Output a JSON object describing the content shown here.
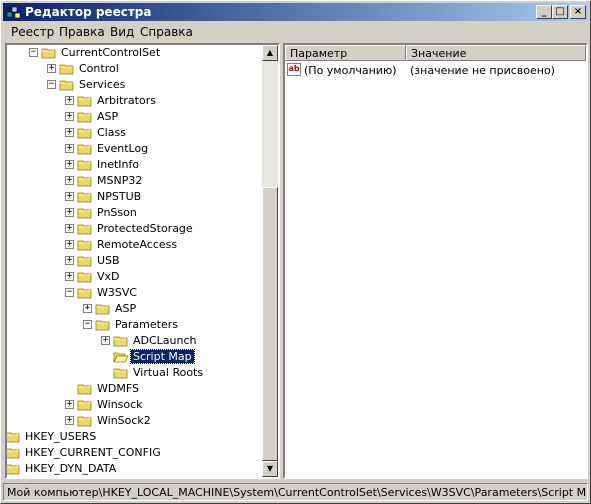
{
  "window": {
    "title": "Редактор реестра"
  },
  "title_buttons": {
    "minimize": "_",
    "maximize": "□",
    "close": "×"
  },
  "menu": [
    "Реестр",
    "Правка",
    "Вид",
    "Справка"
  ],
  "tree": [
    {
      "label": "CurrentControlSet",
      "expander": "−",
      "depth": 3
    },
    {
      "label": "Control",
      "expander": "+",
      "depth": 4
    },
    {
      "label": "Services",
      "expander": "−",
      "depth": 4
    },
    {
      "label": "Arbitrators",
      "expander": "+",
      "depth": 5
    },
    {
      "label": "ASP",
      "expander": "+",
      "depth": 5
    },
    {
      "label": "Class",
      "expander": "+",
      "depth": 5
    },
    {
      "label": "EventLog",
      "expander": "+",
      "depth": 5
    },
    {
      "label": "InetInfo",
      "expander": "+",
      "depth": 5
    },
    {
      "label": "MSNP32",
      "expander": "+",
      "depth": 5
    },
    {
      "label": "NPSTUB",
      "expander": "+",
      "depth": 5
    },
    {
      "label": "PnSson",
      "expander": "+",
      "depth": 5
    },
    {
      "label": "ProtectedStorage",
      "expander": "+",
      "depth": 5
    },
    {
      "label": "RemoteAccess",
      "expander": "+",
      "depth": 5
    },
    {
      "label": "USB",
      "expander": "+",
      "depth": 5
    },
    {
      "label": "VxD",
      "expander": "+",
      "depth": 5
    },
    {
      "label": "W3SVC",
      "expander": "−",
      "depth": 5
    },
    {
      "label": "ASP",
      "expander": "+",
      "depth": 6
    },
    {
      "label": "Parameters",
      "expander": "−",
      "depth": 6
    },
    {
      "label": "ADCLaunch",
      "expander": "+",
      "depth": 7
    },
    {
      "label": "Script Map",
      "expander": "",
      "depth": 7,
      "selected": true,
      "open": true
    },
    {
      "label": "Virtual Roots",
      "expander": "",
      "depth": 7
    },
    {
      "label": "WDMFS",
      "expander": "",
      "depth": 5
    },
    {
      "label": "Winsock",
      "expander": "+",
      "depth": 5
    },
    {
      "label": "WinSock2",
      "expander": "+",
      "depth": 5
    },
    {
      "label": "HKEY_USERS",
      "expander": "+",
      "depth": 1
    },
    {
      "label": "HKEY_CURRENT_CONFIG",
      "expander": "+",
      "depth": 1
    },
    {
      "label": "HKEY_DYN_DATA",
      "expander": "+",
      "depth": 1
    }
  ],
  "list": {
    "columns": [
      "Параметр",
      "Значение"
    ],
    "rows": [
      {
        "name": "(По умолчанию)",
        "value": "(значение не присвоено)",
        "icon": "ab"
      }
    ]
  },
  "scrollbar": {
    "up": "▲",
    "down": "▼"
  },
  "status": "Мой компьютер\\HKEY_LOCAL_MACHINE\\System\\CurrentControlSet\\Services\\W3SVC\\Parameters\\Script Map",
  "colors": {
    "title_start": "#0a246a",
    "title_end": "#a6caf0",
    "folder": "#f4d56c",
    "selection": "#0a246a"
  }
}
